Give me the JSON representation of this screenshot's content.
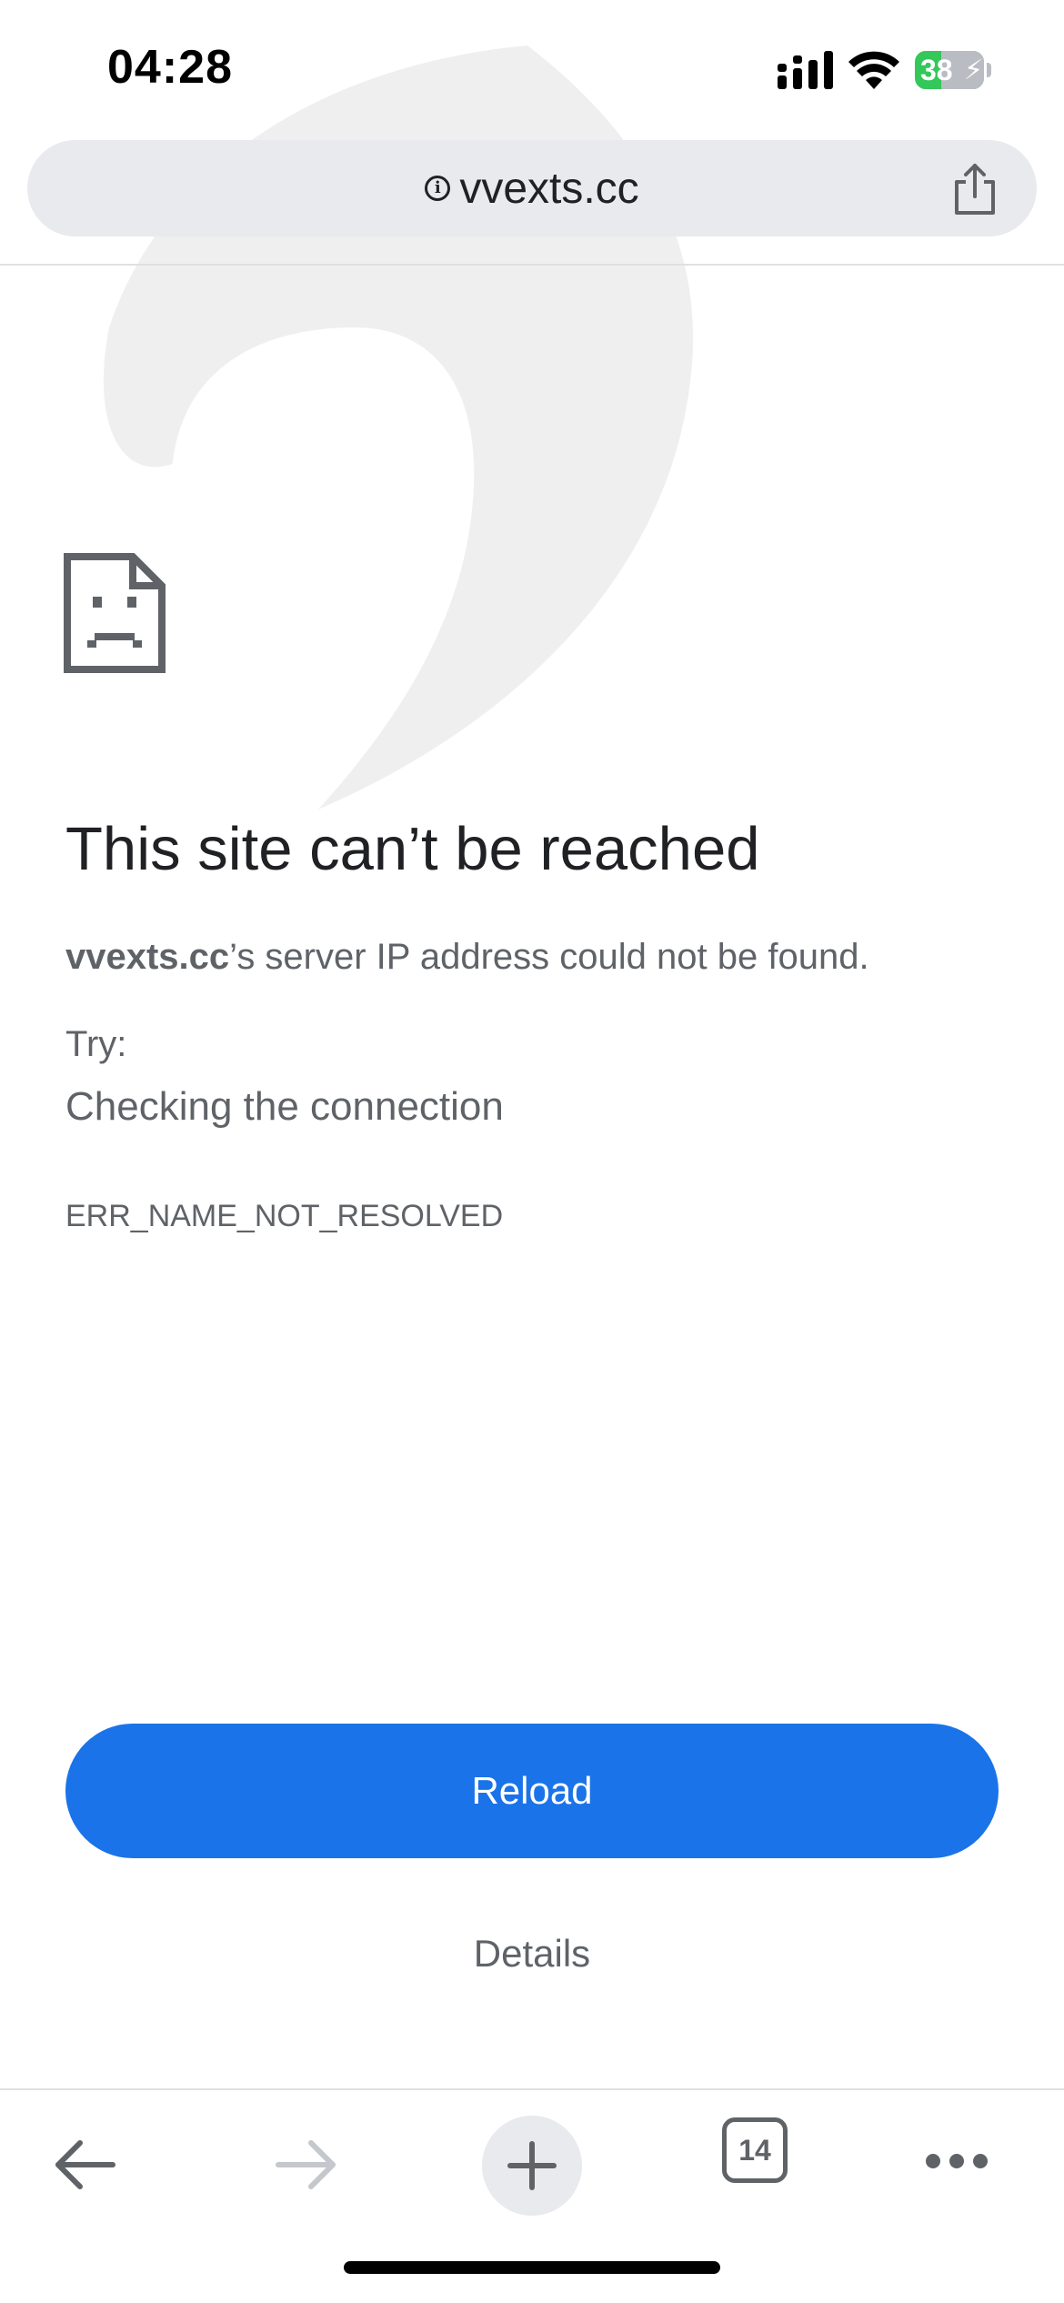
{
  "status_bar": {
    "time": "04:28",
    "battery_level": "38",
    "battery_charging": true
  },
  "url_bar": {
    "url": "vvexts.cc"
  },
  "error_page": {
    "title": "This site can’t be reached",
    "description_host": "vvexts.cc",
    "description_rest": "’s server IP address could not be found.",
    "try_label": "Try:",
    "suggestions": [
      "Checking the connection"
    ],
    "error_code": "ERR_NAME_NOT_RESOLVED",
    "reload_label": "Reload",
    "details_label": "Details"
  },
  "toolbar": {
    "tab_count": "14"
  },
  "colors": {
    "accent": "#1a73e8",
    "battery": "#34c759",
    "secondary_text": "#5f6368",
    "url_bar_bg": "#e8eaed"
  },
  "icons": {
    "status": [
      "signal-icon",
      "wifi-icon",
      "battery-icon"
    ],
    "url_bar": [
      "info-icon",
      "share-icon"
    ],
    "content": [
      "sad-file-icon"
    ],
    "toolbar": [
      "back-icon",
      "forward-icon",
      "plus-icon",
      "tab-switcher-icon",
      "more-icon"
    ]
  }
}
